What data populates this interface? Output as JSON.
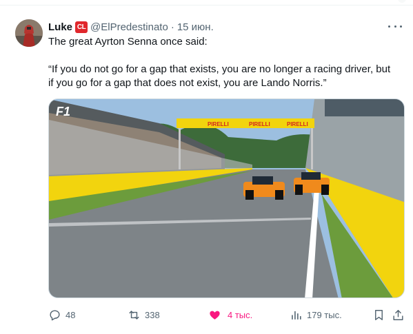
{
  "tweet": {
    "author_name": "Luke",
    "badge": "CL",
    "handle": "@ElPredestinato",
    "separator": "·",
    "date": "15 июн.",
    "text_line1": "The great Ayrton Senna once said:",
    "text_line2": "“If you do not go for a gap that exists, you are no longer a racing driver, but",
    "text_line3": "if you go for a gap that does not exist, you are Lando Norris.”"
  },
  "media": {
    "overlay_logo": "F1",
    "banner_text": "PIRELLI"
  },
  "actions": {
    "replies": "48",
    "retweets": "338",
    "likes": "4 тыс.",
    "views": "179 тыс."
  },
  "colors": {
    "like_active": "#f91880",
    "muted": "#536471",
    "badge_red": "#e0272c",
    "pirelli_yellow": "#f2d40e"
  },
  "icons": {
    "reply": "reply-icon",
    "retweet": "retweet-icon",
    "like": "heart-filled-icon",
    "views": "views-bar-icon",
    "bookmark": "bookmark-icon",
    "share": "share-icon",
    "more": "more-dots-icon"
  }
}
